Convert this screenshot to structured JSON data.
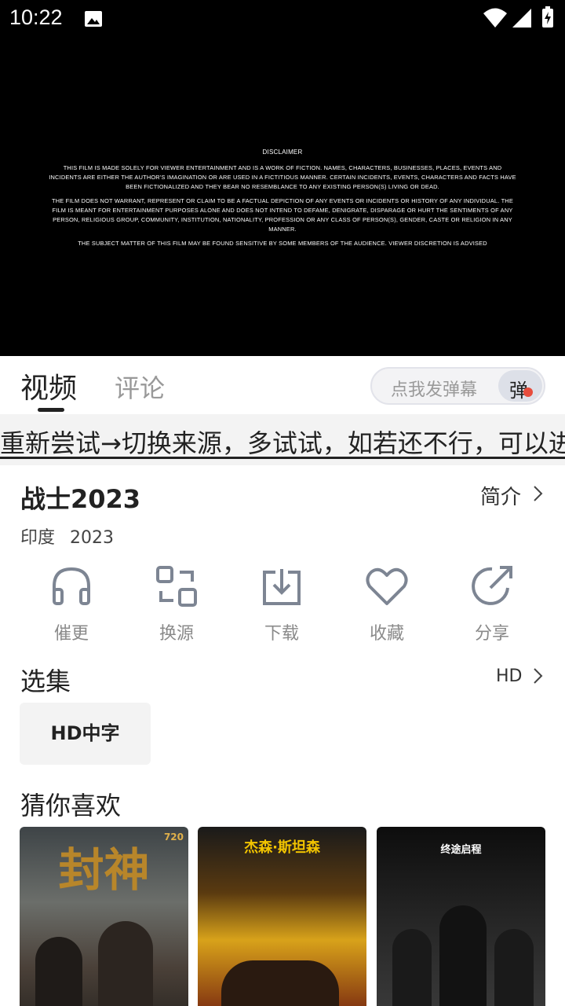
{
  "status_bar": {
    "time": "10:22",
    "icons": [
      "image-icon",
      "wifi-icon",
      "signal-icon",
      "battery-charging-icon"
    ]
  },
  "video": {
    "disclaimer_title": "DISCLAIMER",
    "paragraphs": [
      "THIS FILM IS MADE SOLELY FOR VIEWER ENTERTAINMENT AND IS A WORK OF FICTION. NAMES, CHARACTERS, BUSINESSES, PLACES, EVENTS AND INCIDENTS ARE EITHER THE AUTHOR'S IMAGINATION OR ARE USED IN A FICTITIOUS MANNER. CERTAIN INCIDENTS, EVENTS, CHARACTERS AND FACTS HAVE BEEN FICTIONALIZED AND THEY BEAR NO RESEMBLANCE TO ANY EXISTING PERSON(S) LIVING OR DEAD.",
      "THE FILM DOES NOT WARRANT, REPRESENT OR CLAIM TO BE A FACTUAL DEPICTION OF ANY EVENTS OR INCIDENTS OR HISTORY OF ANY INDIVIDUAL. THE FILM IS MEANT FOR ENTERTAINMENT PURPOSES ALONE AND DOES NOT INTEND TO DEFAME, DENIGRATE, DISPARAGE OR HURT THE SENTIMENTS OF ANY PERSON, RELIGIOUS GROUP, COMMUNITY, INSTITUTION, NATIONALITY, PROFESSION OR ANY CLASS OF PERSON(S), GENDER, CASTE OR RELIGION IN ANY MANNER.",
      "THE SUBJECT MATTER OF THIS FILM MAY BE FOUND SENSITIVE BY SOME MEMBERS OF THE AUDIENCE. VIEWER DISCRETION IS ADVISED"
    ]
  },
  "tabs": [
    {
      "label": "视频",
      "active": true
    },
    {
      "label": "评论",
      "active": false
    }
  ],
  "danmu": {
    "placeholder": "点我发弹幕",
    "toggle_label": "弹"
  },
  "marquee": {
    "text": "重新尝试→切换来源，多试试，如若还不行，可以进"
  },
  "movie": {
    "title": "战士2023",
    "intro_label": "简介",
    "region": "印度",
    "year": "2023"
  },
  "actions": [
    {
      "label": "催更",
      "icon": "headphones-icon"
    },
    {
      "label": "换源",
      "icon": "switch-source-icon"
    },
    {
      "label": "下载",
      "icon": "download-icon"
    },
    {
      "label": "收藏",
      "icon": "heart-icon"
    },
    {
      "label": "分享",
      "icon": "share-icon"
    }
  ],
  "episodes": {
    "title": "选集",
    "quality": "HD",
    "items": [
      "HD中字"
    ]
  },
  "recommend": {
    "title": "猜你喜欢",
    "posters": [
      {
        "title": "封神",
        "corner": "720"
      },
      {
        "title": "杰森·斯坦森"
      },
      {
        "title": "终途启程"
      }
    ]
  },
  "colors": {
    "accent": "#e74c3c",
    "muted": "#8a8a8a",
    "bg_gray": "#f3f3f3"
  }
}
